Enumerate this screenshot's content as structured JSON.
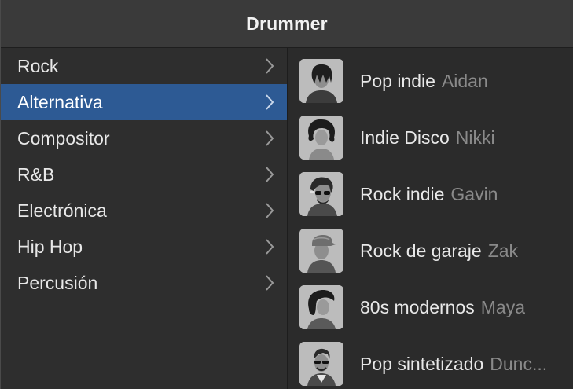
{
  "window": {
    "title": "Drummer"
  },
  "genres": [
    {
      "label": "Rock",
      "selected": false
    },
    {
      "label": "Alternativa",
      "selected": true
    },
    {
      "label": "Compositor",
      "selected": false
    },
    {
      "label": "R&B",
      "selected": false
    },
    {
      "label": "Electrónica",
      "selected": false
    },
    {
      "label": "Hip Hop",
      "selected": false
    },
    {
      "label": "Percusión",
      "selected": false
    }
  ],
  "drummers": [
    {
      "style": "Pop indie",
      "name": "Aidan",
      "icon": "drummer-aidan-avatar"
    },
    {
      "style": "Indie Disco",
      "name": "Nikki",
      "icon": "drummer-nikki-avatar"
    },
    {
      "style": "Rock indie",
      "name": "Gavin",
      "icon": "drummer-gavin-avatar"
    },
    {
      "style": "Rock de garaje",
      "name": "Zak",
      "icon": "drummer-zak-avatar"
    },
    {
      "style": "80s modernos",
      "name": "Maya",
      "icon": "drummer-maya-avatar"
    },
    {
      "style": "Pop sintetizado",
      "name": "Dunc...",
      "icon": "drummer-duncan-avatar"
    }
  ],
  "colors": {
    "selection": "#2d5a94",
    "titlebar": "#3a3a3a",
    "panel": "#2e2e2e",
    "secondary_text": "#8a8a8a"
  }
}
